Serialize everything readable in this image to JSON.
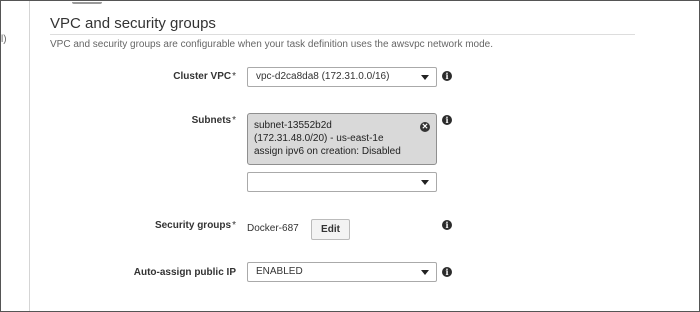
{
  "gutter": {
    "text": "l)"
  },
  "section": {
    "title": "VPC and security groups",
    "description": "VPC and security groups are configurable when your task definition uses the awsvpc network mode."
  },
  "fields": {
    "cluster_vpc": {
      "label": "Cluster VPC",
      "required_mark": "*",
      "value": "vpc-d2ca8da8 (172.31.0.0/16)"
    },
    "subnets": {
      "label": "Subnets",
      "required_mark": "*",
      "selected": {
        "name": "subnet-13552b2d",
        "cidr_zone": "(172.31.48.0/20) - us-east-1e",
        "ipv6": "assign ipv6 on creation: Disabled",
        "remove_glyph": "✕"
      },
      "add_value": ""
    },
    "security_groups": {
      "label": "Security groups",
      "required_mark": "*",
      "value": "Docker-687",
      "edit_label": "Edit"
    },
    "auto_assign_ip": {
      "label": "Auto-assign public IP",
      "value": "ENABLED"
    }
  },
  "icons": {
    "info": "i",
    "info_icon_name": "info-icon",
    "dropdown_icon_name": "chevron-down-icon"
  },
  "colors": {
    "text": "#333333",
    "muted": "#666666",
    "chip_bg": "#d9d9d9",
    "icon": "#2b2b2b"
  }
}
